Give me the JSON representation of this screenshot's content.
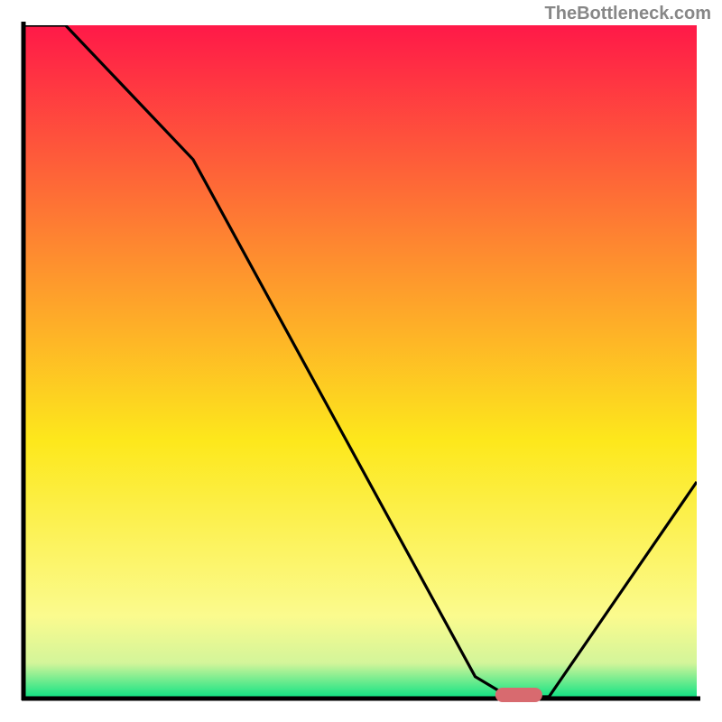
{
  "watermark": "TheBottleneck.com",
  "chart_data": {
    "type": "line",
    "title": "",
    "xlabel": "",
    "ylabel": "",
    "xlim": [
      0,
      100
    ],
    "ylim": [
      0,
      100
    ],
    "x": [
      0,
      6,
      25,
      67,
      72,
      78,
      100
    ],
    "values": [
      100,
      100,
      80,
      3,
      0,
      0,
      32
    ],
    "annotations": [
      {
        "type": "marker",
        "x_start": 70,
        "x_end": 77,
        "y": 0,
        "color": "#d86a6f"
      }
    ],
    "background_gradient": {
      "stops": [
        {
          "offset": 0.0,
          "color": "#ff1948"
        },
        {
          "offset": 0.33,
          "color": "#fe8830"
        },
        {
          "offset": 0.62,
          "color": "#fde81c"
        },
        {
          "offset": 0.88,
          "color": "#fbfb8e"
        },
        {
          "offset": 0.95,
          "color": "#d3f59a"
        },
        {
          "offset": 1.0,
          "color": "#14e384"
        }
      ]
    },
    "axis_frame": {
      "color": "#000000",
      "width": 5
    }
  },
  "colors": {
    "watermark": "#878787",
    "curve": "#000000",
    "marker": "#d86a6f"
  }
}
